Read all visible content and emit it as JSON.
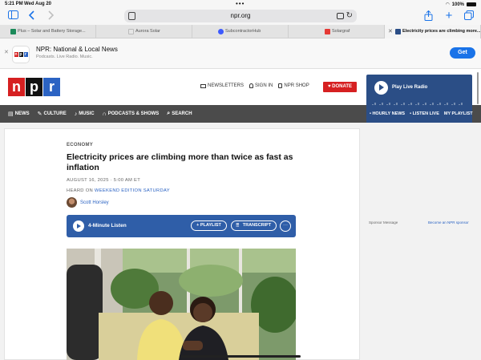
{
  "status": {
    "time": "5:21 PM",
    "date": "Wed Aug 20",
    "battery": "100%"
  },
  "toolbar": {
    "url": "npr.org",
    "icons": [
      "sidebar-icon",
      "back-icon",
      "forward-icon",
      "share-icon",
      "new-tab-icon",
      "tabs-overview-icon"
    ]
  },
  "tabs": [
    {
      "label": "Plus – Solar and Battery Storage...",
      "color": "#1b8a5a",
      "active": false
    },
    {
      "label": "Aurora Solar",
      "color": "#cccccc",
      "active": false
    },
    {
      "label": "SubcontractorHub",
      "color": "#3d5afe",
      "active": false
    },
    {
      "label": "Solargraf",
      "color": "#e53935",
      "active": false
    },
    {
      "label": "Electricity prices are climbing more...",
      "color": "#2b4e86",
      "active": true
    }
  ],
  "banner": {
    "app_name": "NPR: National & Local News",
    "subtitle": "Podcasts. Live Radio. Music.",
    "get_label": "Get"
  },
  "header": {
    "logo_letters": [
      "n",
      "p",
      "r"
    ],
    "logo_colors": [
      "#d62021",
      "#111111",
      "#2b63c3"
    ],
    "links": [
      "NEWSLETTERS",
      "SIGN IN",
      "NPR SHOP"
    ],
    "donate_label": "DONATE",
    "live_label": "Play Live Radio"
  },
  "nav": {
    "items": [
      "NEWS",
      "CULTURE",
      "MUSIC",
      "PODCASTS & SHOWS",
      "SEARCH"
    ],
    "sub_items": [
      "• HOURLY NEWS",
      "• LISTEN LIVE",
      "MY PLAYLIST"
    ]
  },
  "article": {
    "slug": "ECONOMY",
    "headline": "Electricity prices are climbing more than twice as fast as inflation",
    "date": "AUGUST 16, 2025 · 5:00 AM ET",
    "heard_prefix": "HEARD ON ",
    "heard_program": "WEEKEND EDITION SATURDAY",
    "author": "Scott Horsley"
  },
  "player": {
    "listen_label": "4-Minute Listen",
    "playlist_label": "+ PLAYLIST",
    "transcript_label": "TRANSCRIPT",
    "more_label": "···"
  },
  "sidebar": {
    "sponsor_label": "Sponsor Message",
    "sponsor_link": "Become an NPR sponsor"
  }
}
